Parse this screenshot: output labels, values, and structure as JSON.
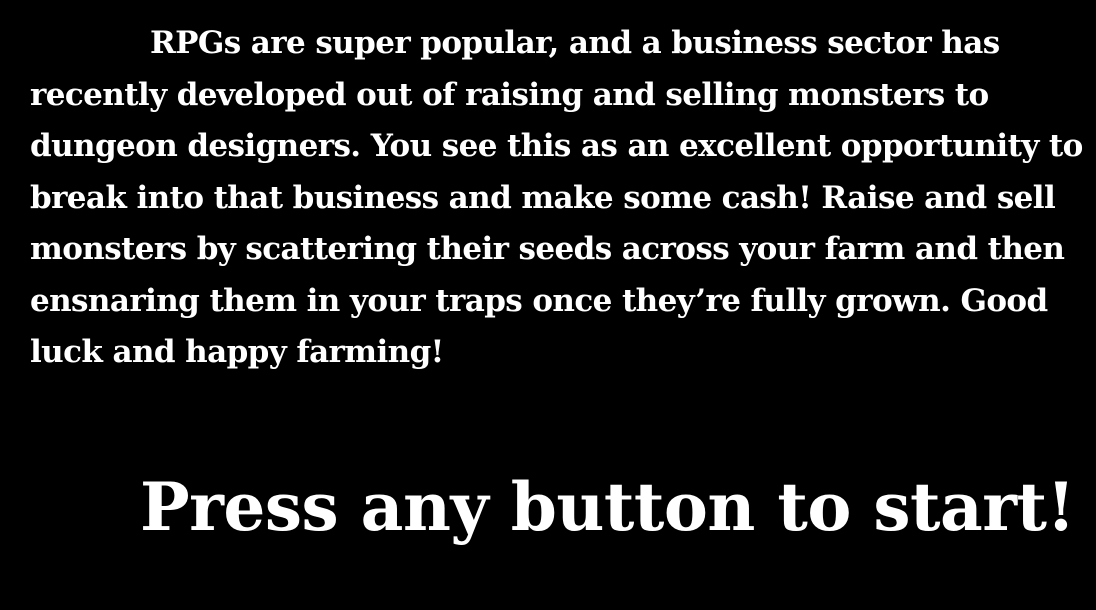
{
  "intro": {
    "lines": [
      "RPGs are super popular, and a business sector has",
      "recently developed out of raising and selling monsters to",
      "dungeon designers.  You see this as an excellent opportunity to",
      "break into that business and make some cash!  Raise and sell",
      "monsters by scattering their seeds across your farm and then",
      "ensnaring them in your traps once they’re fully grown.  Good",
      "luck and happy farming!"
    ]
  },
  "prompt": {
    "label": "Press any button to start!"
  },
  "colors": {
    "background": "#000000",
    "text": "#ffffff"
  }
}
